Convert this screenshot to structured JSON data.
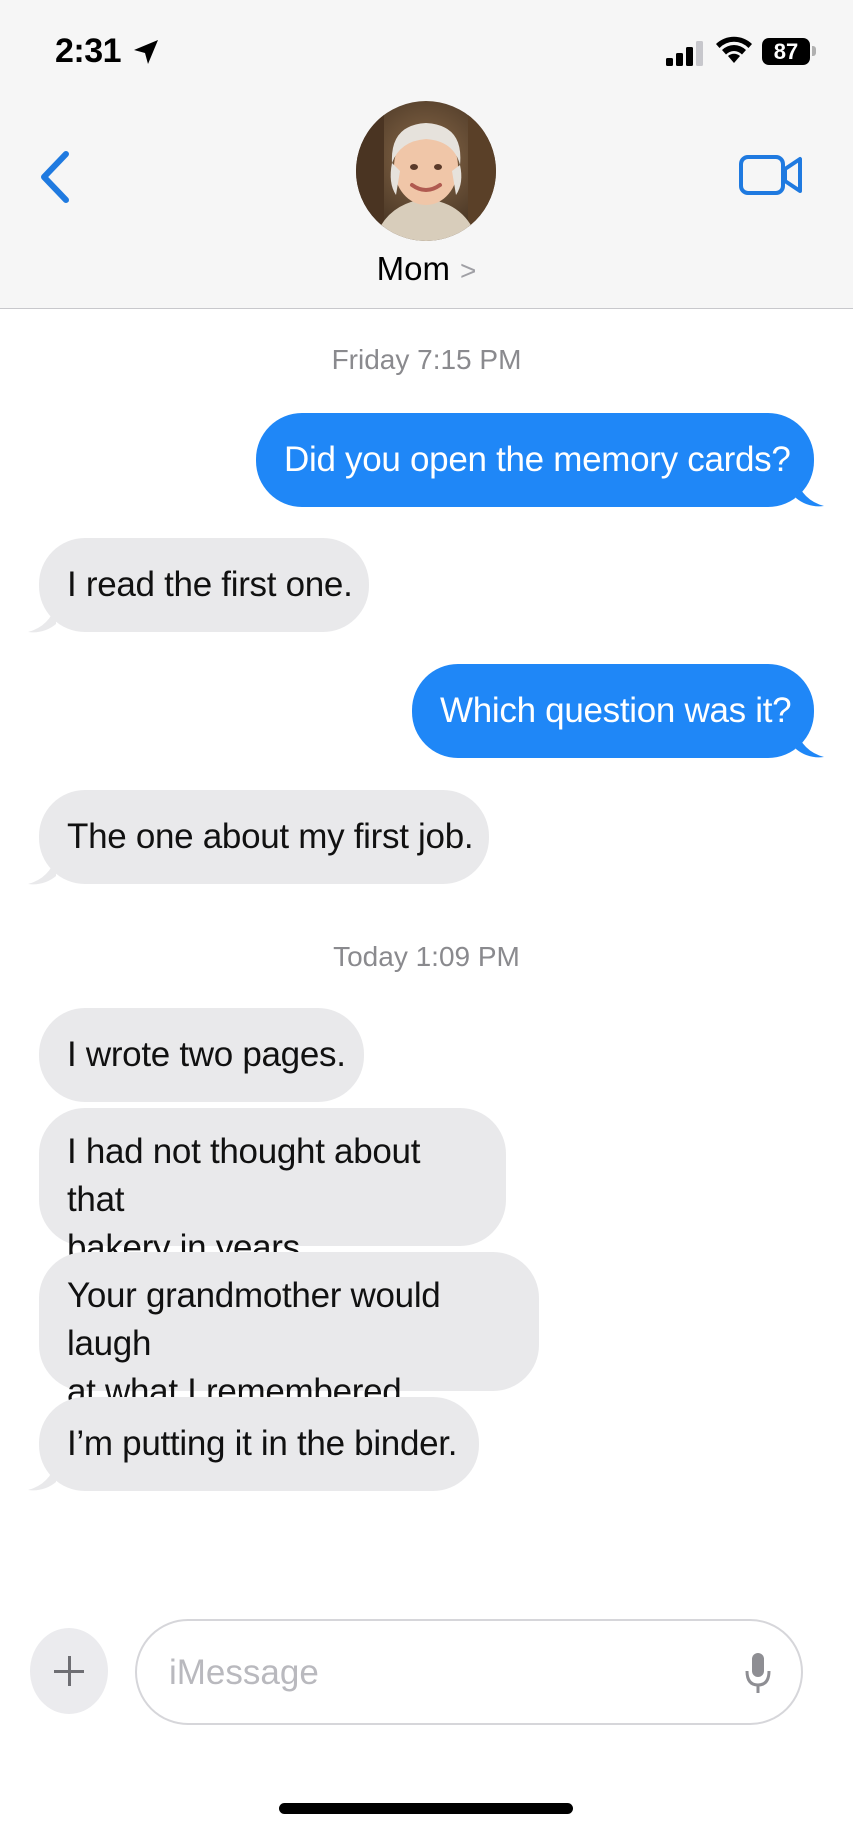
{
  "status_bar": {
    "time": "2:31",
    "battery": "87"
  },
  "header": {
    "contact_name": "Mom",
    "contact_chevron": ">"
  },
  "thread": {
    "stamp_1": "Friday 7:15 PM",
    "stamp_2": "Today 1:09 PM",
    "messages": [
      {
        "from": "me",
        "text": "Did you open the memory cards?"
      },
      {
        "from": "mom",
        "text": "I read the first one."
      },
      {
        "from": "me",
        "text": "Which question was it?"
      },
      {
        "from": "mom",
        "text": "The one about my first job."
      },
      {
        "from": "mom",
        "text": "I wrote two pages."
      },
      {
        "from": "mom",
        "line1": "I had not thought about that",
        "line2": "bakery in years."
      },
      {
        "from": "mom",
        "line1": "Your grandmother would laugh",
        "line2": "at what I remembered."
      },
      {
        "from": "mom",
        "text": "I’m putting it in the binder."
      }
    ]
  },
  "composer": {
    "placeholder": "iMessage"
  },
  "colors": {
    "outgoing": "#1f87f7",
    "incoming": "#e9e9eb",
    "accent": "#1f7ae0"
  },
  "icons": [
    "location-arrow-icon",
    "cellular-signal-icon",
    "wifi-icon",
    "battery-icon",
    "chevron-left-icon",
    "video-camera-icon",
    "plus-icon",
    "microphone-icon"
  ]
}
